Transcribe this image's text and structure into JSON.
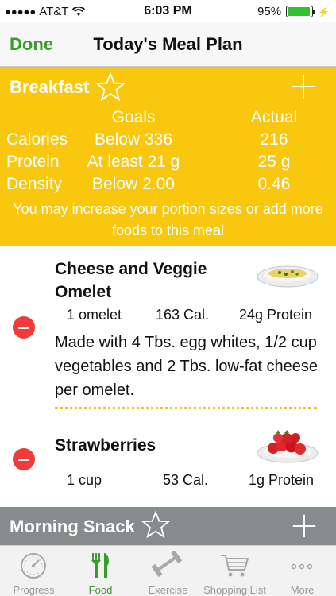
{
  "status_bar": {
    "carrier": "AT&T",
    "time": "6:03 PM",
    "battery": "95%",
    "battery_level": 0.95,
    "battery_color": "#2fc332"
  },
  "nav": {
    "done_label": "Done",
    "title": "Today's Meal Plan"
  },
  "breakfast": {
    "title": "Breakfast",
    "star_icon": "star-outline-icon",
    "add_icon": "plus-icon",
    "color": "#f9c80e",
    "headers": {
      "goals": "Goals",
      "actual": "Actual"
    },
    "rows": [
      {
        "label": "Calories",
        "goal": "Below 336",
        "actual": "216"
      },
      {
        "label": "Protein",
        "goal": "At least 21 g",
        "actual": "25 g"
      },
      {
        "label": "Density",
        "goal": "Below 2.00",
        "actual": "0.46"
      }
    ],
    "advice": "You may increase your portion sizes or add more foods to this meal"
  },
  "foods": [
    {
      "name": "Cheese and Veggie Omelet",
      "serving": "1 omelet",
      "calories": "163 Cal.",
      "protein": "24g Protein",
      "description": "Made with 4 Tbs. egg whites, 1/2 cup vegetables and 2 Tbs. low-fat cheese per omelet.",
      "image_icon": "omelet-plate-icon"
    },
    {
      "name": "Strawberries",
      "serving": "1 cup",
      "calories": "53 Cal.",
      "protein": "1g Protein",
      "image_icon": "strawberries-plate-icon"
    }
  ],
  "morning_snack": {
    "title": "Morning Snack",
    "color": "#868b8b"
  },
  "tabs": [
    {
      "label": "Progress",
      "icon": "gauge-icon",
      "active": false
    },
    {
      "label": "Food",
      "icon": "fork-knife-icon",
      "active": true
    },
    {
      "label": "Exercise",
      "icon": "dumbbell-icon",
      "active": false
    },
    {
      "label": "Shopping List",
      "icon": "cart-icon",
      "active": false
    },
    {
      "label": "More",
      "icon": "more-dots-icon",
      "active": false
    }
  ],
  "accent_color": "#3a9c2d"
}
